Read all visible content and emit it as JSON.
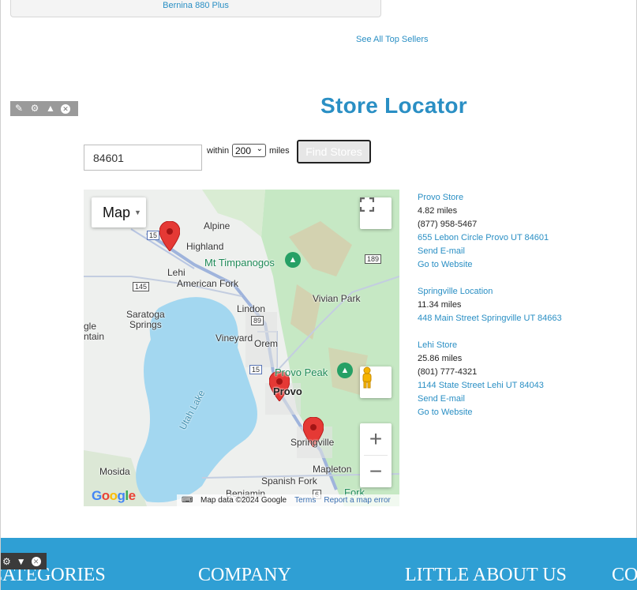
{
  "top_seller": {
    "item_label": "Bernina 880 Plus",
    "see_all_label": "See All Top Sellers"
  },
  "locator": {
    "title": "Store Locator",
    "zip_value": "84601",
    "within_label": "within",
    "radius_value": "200",
    "miles_label": "miles",
    "find_button": "Find Stores"
  },
  "map": {
    "type_label": "Map",
    "attribution": "Map data ©2024 Google",
    "terms_label": "Terms",
    "report_label": "Report a map error",
    "logo_text": "Google",
    "places": {
      "alpine": "Alpine",
      "highland": "Highland",
      "timpanogos": "Mt Timpanogos",
      "lehi": "Lehi",
      "american_fork": "American Fork",
      "vivian_park": "Vivian Park",
      "lindon": "Lindon",
      "saratoga": "Saratoga",
      "springs": "Springs",
      "vineyard": "Vineyard",
      "orem": "Orem",
      "eagle": "gle",
      "mountain": "ntain",
      "provo_peak": "Provo Peak",
      "provo": "Provo",
      "utah_lake": "Utah Lake",
      "springville": "Springville",
      "mosida": "Mosida",
      "mapleton": "Mapleton",
      "spanish_fork": "Spanish Fork",
      "benjamin": "Benjamin",
      "fork": "Fork"
    },
    "shields": {
      "i15_a": "15",
      "i15_b": "15",
      "us89": "89",
      "r145": "145",
      "r189": "189",
      "r6": "6"
    },
    "colors": {
      "water": "#a3d7f0",
      "park": "#c6e8c4",
      "road": "#9fb4dc",
      "pin": "#e53935"
    }
  },
  "stores": [
    {
      "name": "Provo Store",
      "distance": "4.82 miles",
      "phone": "(877) 958-5467",
      "address": "655 Lebon Circle Provo UT 84601",
      "email_label": "Send E-mail",
      "website_label": "Go to Website"
    },
    {
      "name": "Springville Location",
      "distance": "11.34 miles",
      "address": "448 Main Street Springville UT 84663"
    },
    {
      "name": "Lehi Store",
      "distance": "25.86 miles",
      "phone": "(801) 777-4321",
      "address": "1144 State Street Lehi UT 84043",
      "email_label": "Send E-mail",
      "website_label": "Go to Website"
    }
  ],
  "footer": {
    "col1": "CATEGORIES",
    "col2": "COMPANY",
    "col3": "LITTLE ABOUT US",
    "col4": "CONTACT"
  },
  "icons": [
    "pencil-icon",
    "gear-icon",
    "caret-up-icon",
    "close-icon",
    "fullscreen-icon",
    "pegman-icon",
    "zoom-in-icon",
    "zoom-out-icon",
    "map-pin-icon",
    "keyboard-icon",
    "caret-down-icon"
  ]
}
